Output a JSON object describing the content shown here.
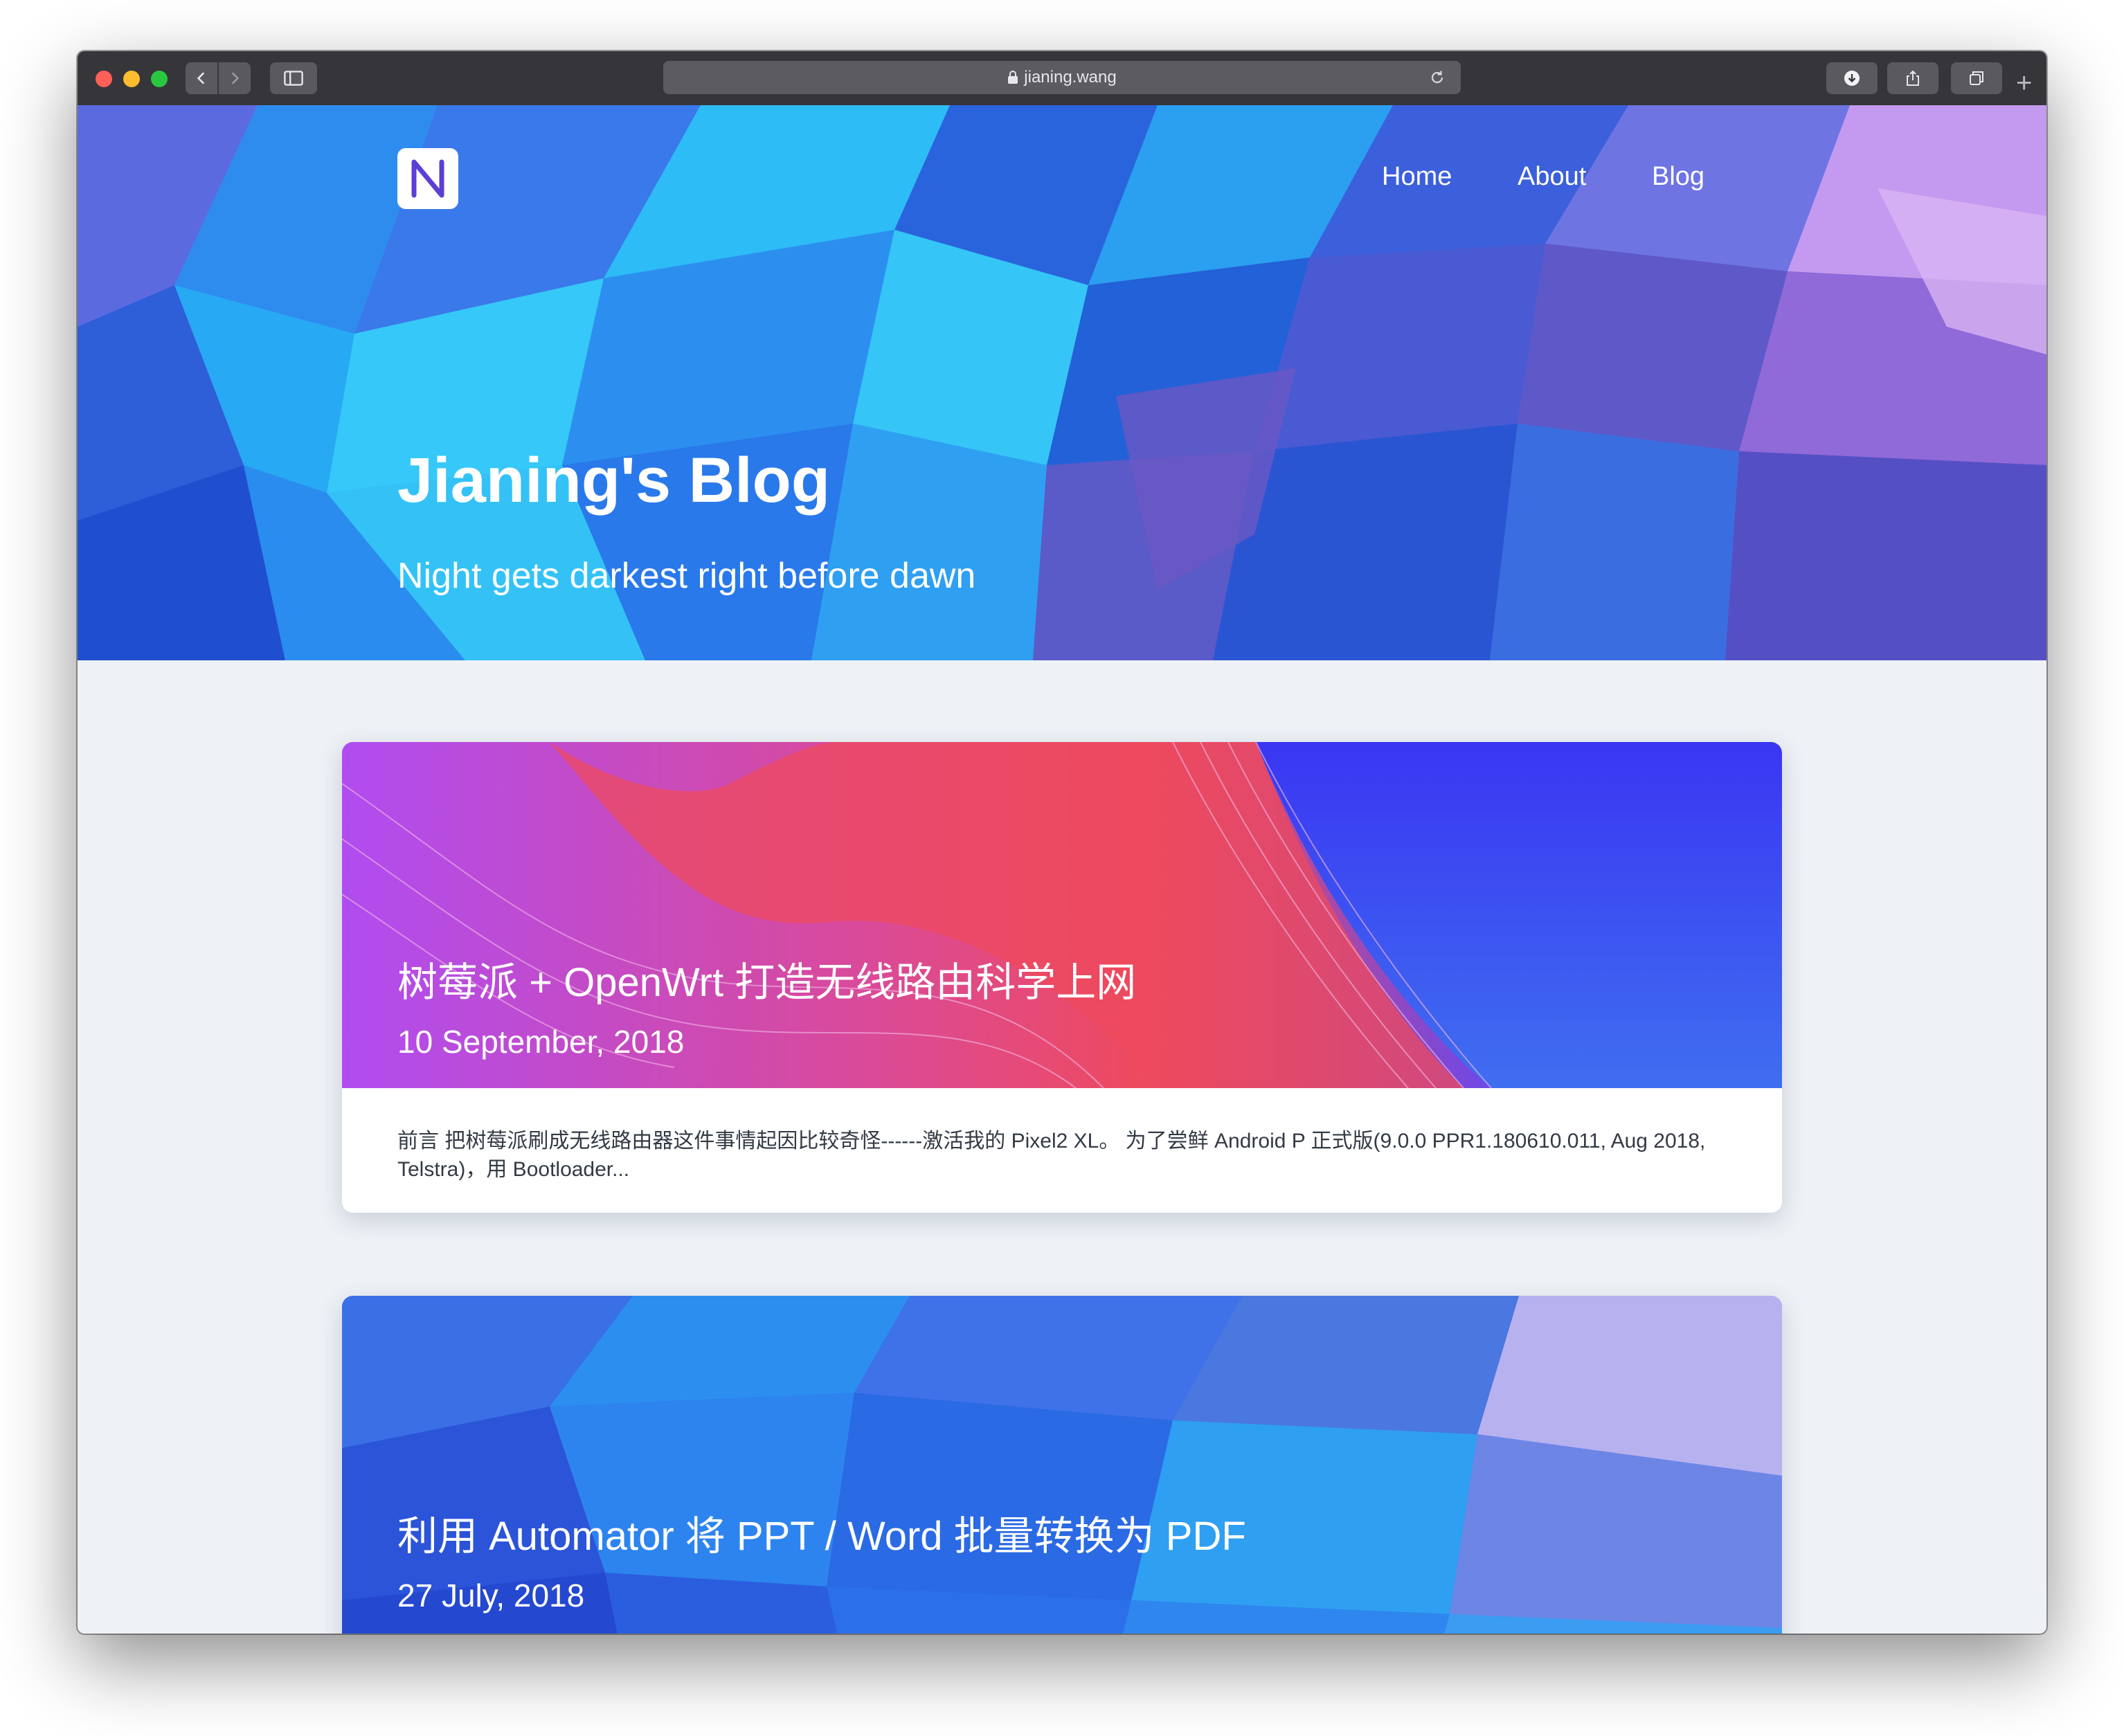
{
  "browser": {
    "url": "jianing.wang"
  },
  "site": {
    "title": "Jianing's Blog",
    "subtitle": "Night gets darkest right before dawn",
    "nav": [
      {
        "label": "Home"
      },
      {
        "label": "About"
      },
      {
        "label": "Blog"
      }
    ]
  },
  "posts": [
    {
      "title": "树莓派 + OpenWrt 打造无线路由科学上网",
      "date": "10 September, 2018",
      "excerpt": "前言 把树莓派刷成无线路由器这件事情起因比较奇怪------激活我的 Pixel2 XL。 为了尝鲜 Android P 正式版(9.0.0 PPR1.180610.011, Aug 2018, Telstra)，用 Bootloader..."
    },
    {
      "title": "利用 Automator 将 PPT / Word 批量转换为 PDF",
      "date": "27 July, 2018"
    }
  ],
  "colors": {
    "page_bg": "#eef2f6",
    "toolbar": "#36353a",
    "hero_primary": "#2f6fe4",
    "card1_accent": "#ee4a5e",
    "card1_bg": "#3f3df5"
  }
}
